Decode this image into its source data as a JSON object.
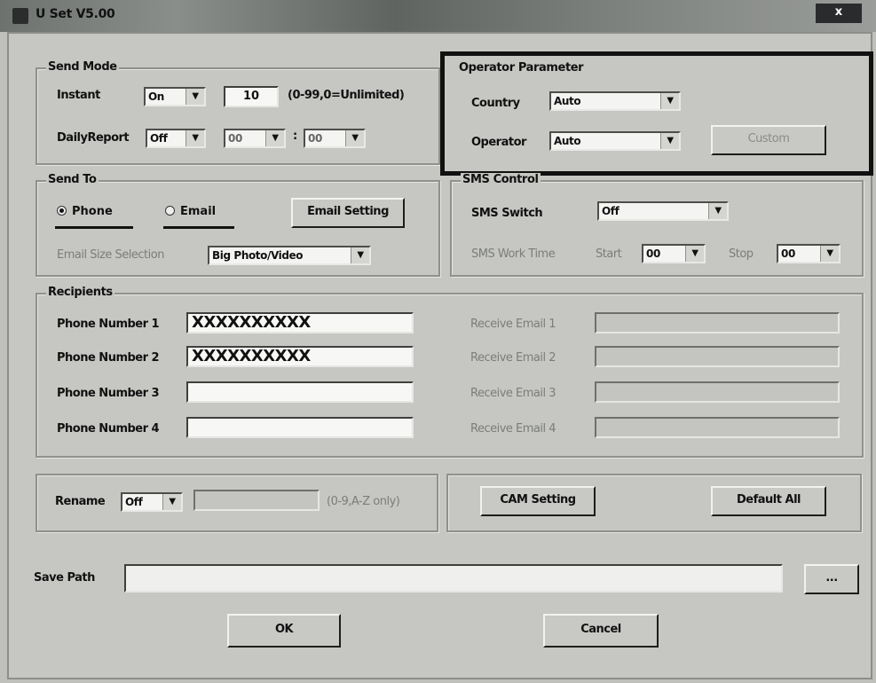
{
  "window": {
    "title": "U Set V5.00",
    "close": "x"
  },
  "send_mode": {
    "title": "Send Mode",
    "instant_label": "Instant",
    "instant_value": "On",
    "count_value": "10",
    "count_hint": "(0-99,0=Unlimited)",
    "daily_label": "DailyReport",
    "daily_value": "Off",
    "hour_value": "00",
    "colon": ":",
    "minute_value": "00"
  },
  "operator": {
    "title": "Operator Parameter",
    "country_label": "Country",
    "country_value": "Auto",
    "operator_label": "Operator",
    "operator_value": "Auto",
    "custom_button": "Custom"
  },
  "send_to": {
    "title": "Send To",
    "phone_label": "Phone",
    "email_label": "Email",
    "email_setting_button": "Email Setting",
    "size_label": "Email Size Selection",
    "size_value": "Big Photo/Video"
  },
  "sms": {
    "title": "SMS Control",
    "switch_label": "SMS Switch",
    "switch_value": "Off",
    "work_time_label": "SMS Work Time",
    "start_label": "Start",
    "start_value": "00",
    "stop_label": "Stop",
    "stop_value": "00"
  },
  "recipients": {
    "title": "Recipients",
    "phones": [
      {
        "label": "Phone Number 1",
        "value": "XXXXXXXXXX"
      },
      {
        "label": "Phone Number 2",
        "value": "XXXXXXXXXX"
      },
      {
        "label": "Phone Number 3",
        "value": ""
      },
      {
        "label": "Phone Number 4",
        "value": ""
      }
    ],
    "emails": [
      {
        "label": "Receive Email 1",
        "value": ""
      },
      {
        "label": "Receive Email 2",
        "value": ""
      },
      {
        "label": "Receive Email 3",
        "value": ""
      },
      {
        "label": "Receive Email 4",
        "value": ""
      }
    ]
  },
  "rename": {
    "label": "Rename",
    "value": "Off",
    "hint": "(0-9,A-Z only)"
  },
  "actions": {
    "cam_setting": "CAM Setting",
    "default_all": "Default All"
  },
  "save_path": {
    "label": "Save Path",
    "browse": "..."
  },
  "footer": {
    "ok": "OK",
    "cancel": "Cancel"
  },
  "icons": {
    "dropdown": "chevron-down-icon"
  }
}
